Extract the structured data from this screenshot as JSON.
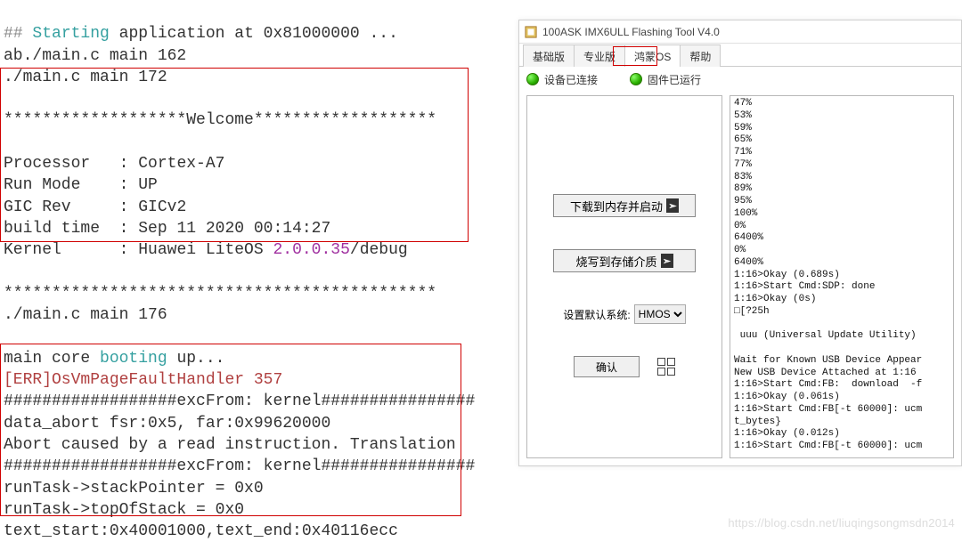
{
  "terminal": {
    "line1_prefix": "##",
    "line1_start": "Starting",
    "line1_rest": " application at 0x81000000 ...",
    "line2": "ab./main.c main 162",
    "line3": "./main.c main 172",
    "welcome_header": "*******************Welcome*******************",
    "proc_label": "Processor   : ",
    "proc_value": "Cortex-A7",
    "mode_label": "Run Mode    : ",
    "mode_value": "UP",
    "gic_label": "GIC Rev     : ",
    "gic_value": "GICv2",
    "build_label": "build time  : ",
    "build_value": "Sep 11 2020 00:14:27",
    "kernel_label": "Kernel      : ",
    "kernel_value_1": "Huawei LiteOS ",
    "kernel_version": "2.0.0.35",
    "kernel_value_2": "/debug",
    "stars": "*********************************************",
    "line_after": "./main.c main 176",
    "boot_prefix": "main core ",
    "boot_kw": "booting",
    "boot_suffix": " up...",
    "err1": "[ERR]OsVmPageFaultHandler 357",
    "hash1": "##################excFrom: kernel################",
    "abort1": "data_abort fsr:0x5, far:0x99620000",
    "abort2": "Abort caused by a read instruction. Translation",
    "hash2": "##################excFrom: kernel################",
    "rt1": "runTask->stackPointer = 0x0",
    "rt2": "runTask->topOfStack = 0x0",
    "textseg": "text_start:0x40001000,text_end:0x40116ecc"
  },
  "tool": {
    "title": "100ASK IMX6ULL Flashing Tool V4.0",
    "tabs": [
      "基础版",
      "专业版",
      "鸿蒙OS",
      "帮助"
    ],
    "active_tab": 2,
    "status": {
      "connected": "设备已连接",
      "running": "固件已运行"
    },
    "buttons": {
      "download_boot": "下载到内存并启动",
      "burn_storage": "烧写到存储介质",
      "confirm": "确认"
    },
    "default_system_label": "设置默认系统:",
    "default_system_value": "HMOS",
    "log_lines": [
      "47%",
      "53%",
      "59%",
      "65%",
      "71%",
      "77%",
      "83%",
      "89%",
      "95%",
      "100%",
      "0%",
      "6400%",
      "0%",
      "6400%",
      "1:16>Okay (0.689s)",
      "1:16>Start Cmd:SDP: done",
      "1:16>Okay (0s)",
      "□[?25h",
      "",
      " uuu (Universal Update Utility)",
      "",
      "Wait for Known USB Device Appear",
      "New USB Device Attached at 1:16",
      "1:16>Start Cmd:FB:  download  -f",
      "1:16>Okay (0.061s)",
      "1:16>Start Cmd:FB[-t 60000]: ucm",
      "t_bytes}",
      "1:16>Okay (0.012s)",
      "1:16>Start Cmd:FB[-t 60000]: ucm"
    ]
  },
  "watermark": "https://blog.csdn.net/liuqingsongmsdn2014"
}
